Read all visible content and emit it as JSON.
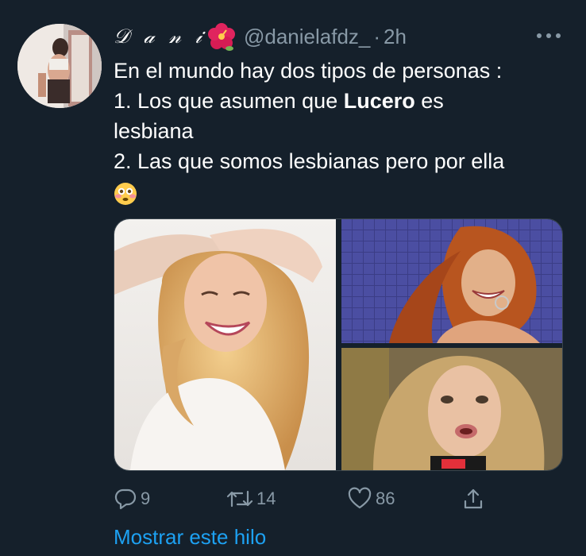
{
  "tweet": {
    "display_name": "𝒟 𝒶 𝓃 𝒾",
    "name_emoji": "hibiscus-flower",
    "handle": "@danielafdz_",
    "separator": "·",
    "time": "2h",
    "text": {
      "line1": "En el mundo hay dos tipos de personas :",
      "line2_prefix": "1. Los que asumen que ",
      "line2_bold": "Lucero",
      "line2_suffix": " es",
      "line3": "lesbiana",
      "line4": "2. Las que somos lesbianas pero por ella",
      "trailing_emoji": "flushed-face"
    },
    "media": {
      "count": 3,
      "photos": [
        "woman-laughing-blonde-curls",
        "woman-red-curly-hair",
        "woman-blonde-speaking-microphone"
      ]
    },
    "actions": {
      "reply_count": "9",
      "retweet_count": "14",
      "like_count": "86"
    },
    "show_thread_label": "Mostrar este hilo"
  },
  "colors": {
    "background": "#15202b",
    "text_primary": "#ffffff",
    "text_secondary": "#8899a6",
    "accent": "#1da1f2",
    "border": "#38444d"
  }
}
